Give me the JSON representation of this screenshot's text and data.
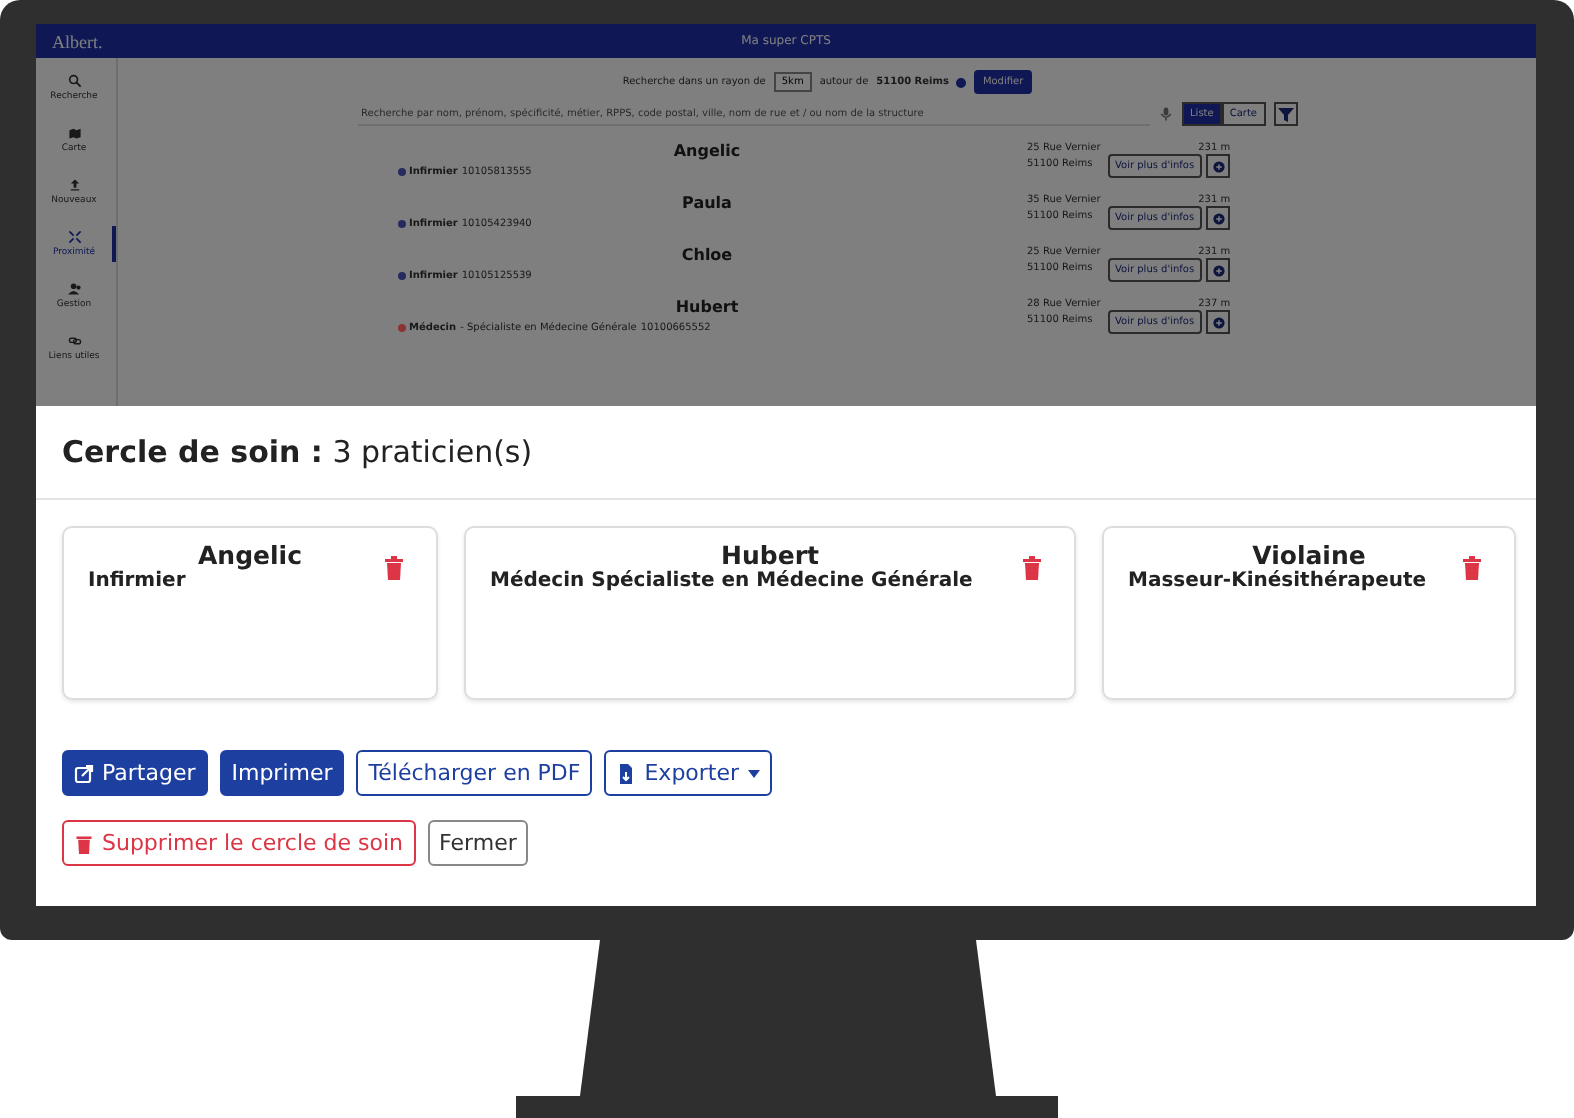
{
  "app": {
    "logo": "Albert.",
    "title": "Ma super CPTS"
  },
  "sidebar": {
    "items": [
      {
        "label": "Recherche",
        "selected": false
      },
      {
        "label": "Carte",
        "selected": false
      },
      {
        "label": "Nouveaux",
        "selected": false
      },
      {
        "label": "Proximité",
        "selected": true
      },
      {
        "label": "Gestion",
        "selected": false
      },
      {
        "label": "Liens utiles",
        "selected": false
      }
    ]
  },
  "search": {
    "radius_label": "Recherche dans un rayon de",
    "radius": "5km",
    "around_label": "autour de",
    "place": "51100 Reims",
    "modify": "Modifier",
    "placeholder": "Recherche par nom, prénom, spécificité, métier, RPPS, code postal, ville, nom de rue et / ou nom de la structure",
    "views": [
      {
        "label": "Liste",
        "selected": true
      },
      {
        "label": "Carte",
        "selected": false
      }
    ]
  },
  "results": [
    {
      "name": "Angelic",
      "role": "Infirmier",
      "rpps": "10105813555",
      "color": "#252b5e",
      "street": "25 Rue Vernier",
      "city": "51100 Reims",
      "distance": "231 m",
      "button": "Voir plus d'infos"
    },
    {
      "name": "Paula",
      "role": "Infirmier",
      "rpps": "10105423940",
      "color": "#252b5e",
      "street": "35 Rue Vernier",
      "city": "51100 Reims",
      "distance": "231 m",
      "button": "Voir plus d'infos"
    },
    {
      "name": "Chloe",
      "role": "Infirmier",
      "rpps": "10105125539",
      "color": "#252b5e",
      "street": "25 Rue Vernier",
      "city": "51100 Reims",
      "distance": "231 m",
      "button": "Voir plus d'infos"
    },
    {
      "name": "Hubert",
      "role": "Médecin",
      "detail": "- Spécialiste en Médecine Générale",
      "rpps": "10100665552",
      "color": "#8c3434",
      "street": "28 Rue Vernier",
      "city": "51100 Reims",
      "distance": "237 m",
      "button": "Voir plus d'infos"
    }
  ],
  "circle": {
    "title": "**Cercle de soin :** 3 praticien(s)",
    "members": [
      {
        "name": "Angelic",
        "role": "Infirmier"
      },
      {
        "name": "Hubert",
        "role": "Médecin Spécialiste en Médecine Générale"
      },
      {
        "name": "Violaine",
        "role": "Masseur-Kinésithérapeute"
      }
    ],
    "actions": [
      {
        "label": "Partager",
        "kind": "share"
      },
      {
        "label": "Imprimer",
        "kind": "primary"
      },
      {
        "label": "Télécharger en PDF",
        "kind": "outline"
      },
      {
        "label": "Exporter",
        "kind": "export",
        "dropdown": true
      }
    ],
    "danger": {
      "label": "Supprimer le cercle de soin"
    },
    "close": {
      "label": "Fermer"
    }
  }
}
